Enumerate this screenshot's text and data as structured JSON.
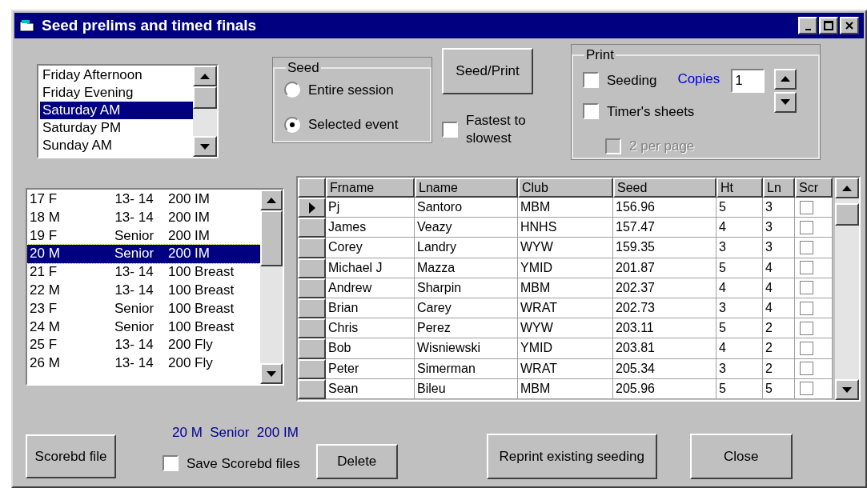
{
  "window": {
    "title": "Seed prelims and timed finals"
  },
  "sessions": [
    {
      "label": "Friday Afternoon",
      "selected": false
    },
    {
      "label": "Friday Evening",
      "selected": false
    },
    {
      "label": "Saturday AM",
      "selected": true
    },
    {
      "label": "Saturday PM",
      "selected": false
    },
    {
      "label": "Sunday AM",
      "selected": false
    }
  ],
  "seed_group": {
    "title": "Seed",
    "options": [
      {
        "label": "Entire session",
        "selected": false
      },
      {
        "label": "Selected event",
        "selected": true
      }
    ]
  },
  "seed_print_button": "Seed/Print",
  "fastest_to_slowest": {
    "label": "Fastest to slowest",
    "checked": false
  },
  "print_group": {
    "title": "Print",
    "seeding": {
      "label": "Seeding",
      "checked": false
    },
    "copies_label": "Copies",
    "copies_value": "1",
    "timers_sheets": {
      "label": "Timer's sheets",
      "checked": false
    },
    "two_per_page": {
      "label": "2 per page",
      "checked": false,
      "disabled": true
    }
  },
  "events": [
    {
      "number": "17 F",
      "age": "13- 14",
      "event": "200 IM",
      "selected": false
    },
    {
      "number": "18 M",
      "age": "13- 14",
      "event": "200 IM",
      "selected": false
    },
    {
      "number": "19 F",
      "age": "Senior",
      "event": "200 IM",
      "selected": false
    },
    {
      "number": "20 M",
      "age": "Senior",
      "event": "200 IM",
      "selected": true
    },
    {
      "number": "21 F",
      "age": "13- 14",
      "event": "100 Breast",
      "selected": false
    },
    {
      "number": "22 M",
      "age": "13- 14",
      "event": "100 Breast",
      "selected": false
    },
    {
      "number": "23 F",
      "age": "Senior",
      "event": "100 Breast",
      "selected": false
    },
    {
      "number": "24 M",
      "age": "Senior",
      "event": "100 Breast",
      "selected": false
    },
    {
      "number": "25 F",
      "age": "13- 14",
      "event": "200 Fly",
      "selected": false
    },
    {
      "number": "26 M",
      "age": "13- 14",
      "event": "200 Fly",
      "selected": false
    }
  ],
  "table": {
    "columns": [
      "Frname",
      "Lname",
      "Club",
      "Seed",
      "Ht",
      "Ln",
      "Scr"
    ],
    "rows": [
      {
        "current": true,
        "cells": [
          "Pj",
          "Santoro",
          "MBM",
          "156.96",
          "5",
          "3"
        ],
        "scr": false
      },
      {
        "current": false,
        "cells": [
          "James",
          "Veazy",
          "HNHS",
          "157.47",
          "4",
          "3"
        ],
        "scr": false
      },
      {
        "current": false,
        "cells": [
          "Corey",
          "Landry",
          "WYW",
          "159.35",
          "3",
          "3"
        ],
        "scr": false
      },
      {
        "current": false,
        "cells": [
          "Michael J",
          "Mazza",
          "YMID",
          "201.87",
          "5",
          "4"
        ],
        "scr": false
      },
      {
        "current": false,
        "cells": [
          "Andrew",
          "Sharpin",
          "MBM",
          "202.37",
          "4",
          "4"
        ],
        "scr": false
      },
      {
        "current": false,
        "cells": [
          "Brian",
          "Carey",
          "WRAT",
          "202.73",
          "3",
          "4"
        ],
        "scr": false
      },
      {
        "current": false,
        "cells": [
          "Chris",
          "Perez",
          "WYW",
          "203.11",
          "5",
          "2"
        ],
        "scr": false
      },
      {
        "current": false,
        "cells": [
          "Bob",
          "Wisniewski",
          "YMID",
          "203.81",
          "4",
          "2"
        ],
        "scr": false
      },
      {
        "current": false,
        "cells": [
          "Peter",
          "Simerman",
          "WRAT",
          "205.34",
          "3",
          "2"
        ],
        "scr": false
      },
      {
        "current": false,
        "cells": [
          "Sean",
          "Bileu",
          "MBM",
          "205.96",
          "5",
          "5"
        ],
        "scr": false
      }
    ]
  },
  "selected_event_label": "20 M  Senior  200 IM",
  "scorebd_file_button": "Scorebd file",
  "save_scorebd_files": {
    "label": "Save Scorebd files",
    "checked": false
  },
  "delete_button": "Delete",
  "reprint_button": "Reprint existing seeding",
  "close_button": "Close"
}
